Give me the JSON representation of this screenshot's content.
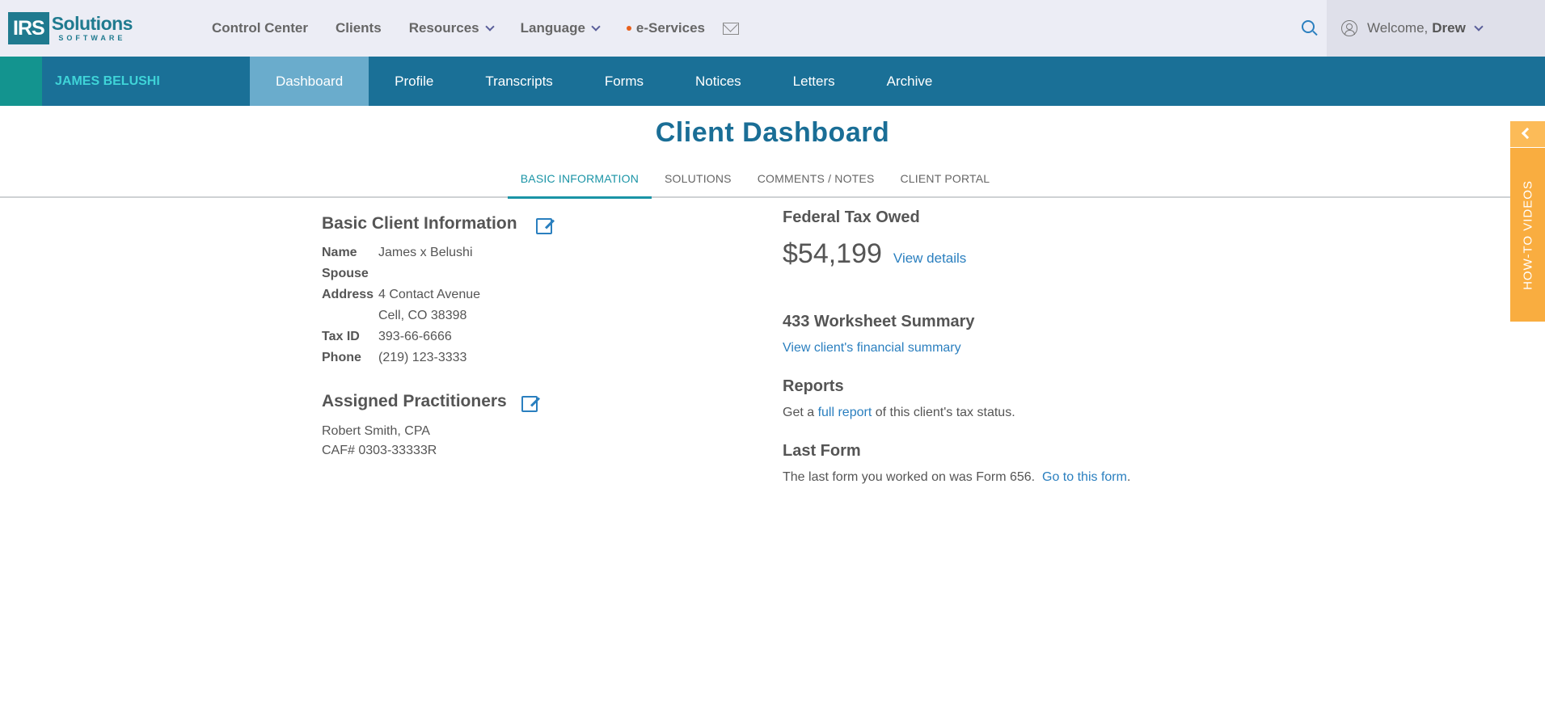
{
  "brand": {
    "logo_box": "IRS",
    "logo_word": "Solutions",
    "logo_sub": "SOFTWARE",
    "primary": "#1a7097",
    "accent": "#13948f",
    "orange": "#f9ad40"
  },
  "nav": {
    "control_center": "Control Center",
    "clients": "Clients",
    "resources": "Resources",
    "language": "Language",
    "eservices": "e-Services"
  },
  "user": {
    "welcome": "Welcome,",
    "name": "Drew"
  },
  "client": {
    "name": "JAMES BELUSHI",
    "tabs": [
      "Dashboard",
      "Profile",
      "Transcripts",
      "Forms",
      "Notices",
      "Letters",
      "Archive"
    ]
  },
  "page": {
    "title": "Client Dashboard",
    "subtabs": [
      "BASIC INFORMATION",
      "SOLUTIONS",
      "COMMENTS / NOTES",
      "CLIENT PORTAL"
    ]
  },
  "basic_info": {
    "heading": "Basic Client Information",
    "name_label": "Name",
    "name_value": "James x Belushi",
    "spouse_label": "Spouse",
    "spouse_value": "",
    "address_label": "Address",
    "address_line1": "4 Contact Avenue",
    "address_line2": "Cell, CO 38398",
    "taxid_label": "Tax ID",
    "taxid_value": "393-66-6666",
    "phone_label": "Phone",
    "phone_value": "(219) 123-3333"
  },
  "practitioners": {
    "heading": "Assigned Practitioners",
    "name": "Robert Smith, CPA",
    "caf": "CAF# 0303-33333R"
  },
  "federal": {
    "heading": "Federal Tax Owed",
    "amount": "$54,199",
    "link": "View details"
  },
  "worksheet": {
    "heading": "433 Worksheet Summary",
    "link": "View client's financial summary"
  },
  "reports": {
    "heading": "Reports",
    "prefix": "Get a ",
    "link": "full report",
    "suffix": " of this client's tax status."
  },
  "last_form": {
    "heading": "Last Form",
    "text": "The last form you worked on was Form 656.  ",
    "link": "Go to this form",
    "suffix": "."
  },
  "side": {
    "label": "HOW-TO VIDEOS"
  }
}
